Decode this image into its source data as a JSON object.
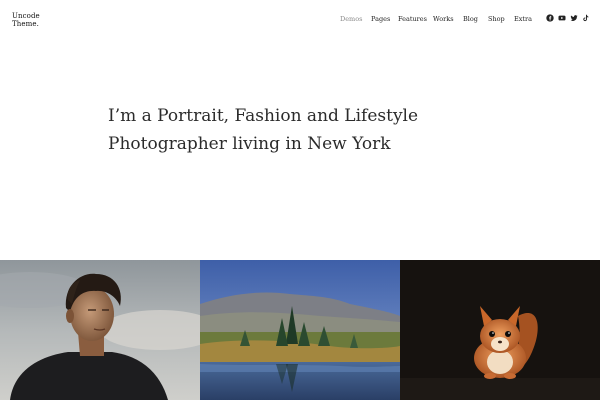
{
  "logo": {
    "line1": "Uncode",
    "line2": "Theme."
  },
  "nav": {
    "items": [
      {
        "label": "Demos",
        "active": true
      },
      {
        "label": "Pages",
        "active": false
      },
      {
        "label": "Features",
        "active": false
      },
      {
        "label": "Works",
        "active": false
      },
      {
        "label": "Blog",
        "active": false
      },
      {
        "label": "Shop",
        "active": false
      },
      {
        "label": "Extra",
        "active": false
      }
    ]
  },
  "social": {
    "icons": [
      "facebook-icon",
      "youtube-icon",
      "twitter-icon",
      "tiktok-icon"
    ]
  },
  "hero": {
    "line1": "I’m a Portrait, Fashion and Lifestyle",
    "line2": "Photographer living in New York"
  },
  "colors": {
    "nav_active": "#8a8a8a",
    "text": "#2b2b2b",
    "background": "#ffffff"
  }
}
